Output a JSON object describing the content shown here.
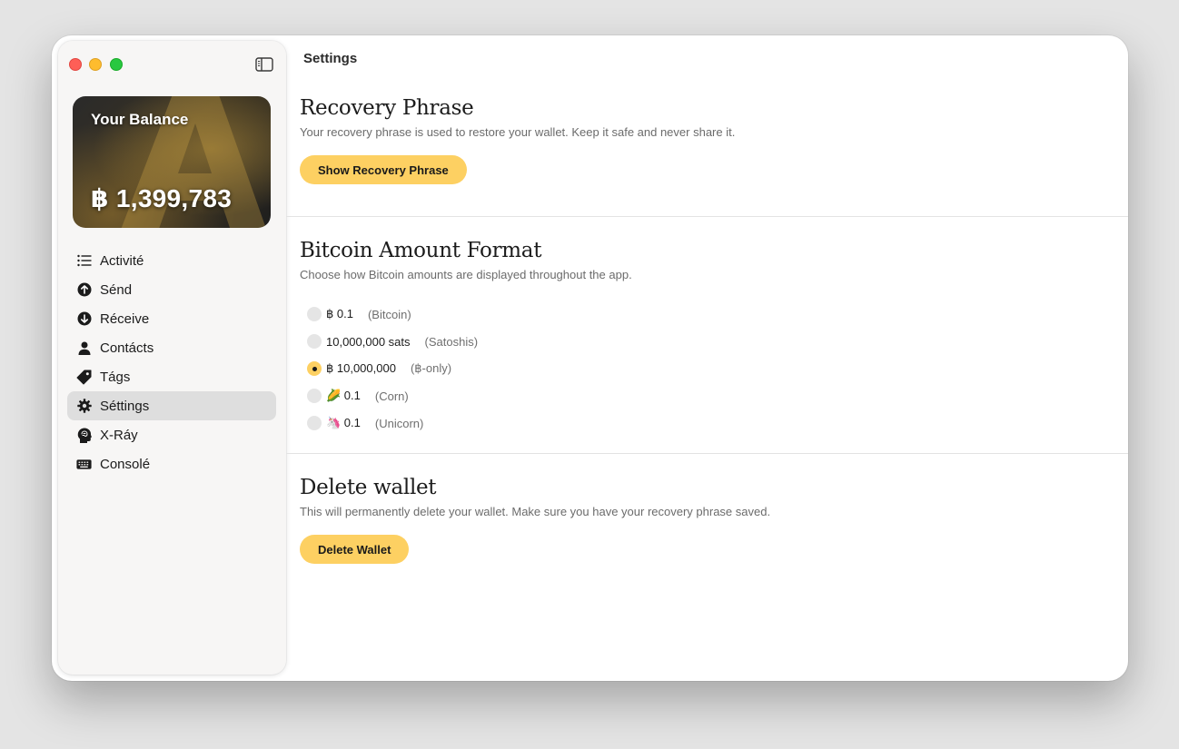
{
  "header": {
    "title": "Settings"
  },
  "balance": {
    "title": "Your Balance",
    "amount": "฿ 1,399,783"
  },
  "sidebar": {
    "items": [
      {
        "label": "Activité",
        "icon": "list-icon"
      },
      {
        "label": "Sénd",
        "icon": "arrow-up-circle-icon"
      },
      {
        "label": "Réceive",
        "icon": "arrow-down-circle-icon"
      },
      {
        "label": "Contácts",
        "icon": "person-icon"
      },
      {
        "label": "Tágs",
        "icon": "tag-icon"
      },
      {
        "label": "Séttings",
        "icon": "gear-icon",
        "active": true
      },
      {
        "label": "X-Ráy",
        "icon": "head-brain-icon"
      },
      {
        "label": "Consolé",
        "icon": "keyboard-icon"
      }
    ]
  },
  "recovery": {
    "title": "Recovery Phrase",
    "description": "Your recovery phrase is used to restore your wallet. Keep it safe and never share it.",
    "button": "Show Recovery Phrase"
  },
  "format": {
    "title": "Bitcoin Amount Format",
    "description": "Choose how Bitcoin amounts are displayed throughout the app.",
    "selected_index": 2,
    "options": [
      {
        "label": "฿ 0.1",
        "note": "(Bitcoin)"
      },
      {
        "label": "10,000,000 sats",
        "note": "(Satoshis)"
      },
      {
        "label": "฿ 10,000,000",
        "note": "(฿-only)"
      },
      {
        "label": "🌽 0.1",
        "note": "(Corn)"
      },
      {
        "label": "🦄 0.1",
        "note": "(Unicorn)"
      }
    ]
  },
  "delete": {
    "title": "Delete wallet",
    "description": "This will permanently delete your wallet. Make sure you have your recovery phrase saved.",
    "button": "Delete Wallet"
  },
  "colors": {
    "accent": "#fdd062",
    "sidebar_bg": "#f7f6f5",
    "active_item_bg": "#dedede"
  }
}
